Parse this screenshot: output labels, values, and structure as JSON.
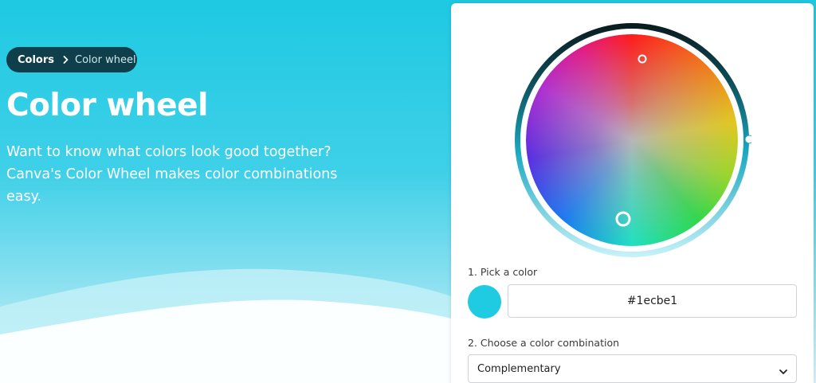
{
  "breadcrumb": {
    "parent": "Colors",
    "current": "Color wheel",
    "separator_icon": "chevron-right-icon"
  },
  "page": {
    "title": "Color wheel",
    "description_line1": "Want to know what colors look good together?",
    "description_line2": "Canva's Color Wheel makes color combinations",
    "description_line3": "easy."
  },
  "picker": {
    "step1_label": "1. Pick a color",
    "hex_value": "#1ecbe1",
    "swatch_color": "#1ecbe1",
    "step2_label": "2. Choose a color combination",
    "combination_selected": "Complementary",
    "dropdown_icon": "chevron-down-icon"
  },
  "colors": {
    "hero_accent": "#1ec9e2",
    "breadcrumb_bg": "#0f3f4a"
  }
}
